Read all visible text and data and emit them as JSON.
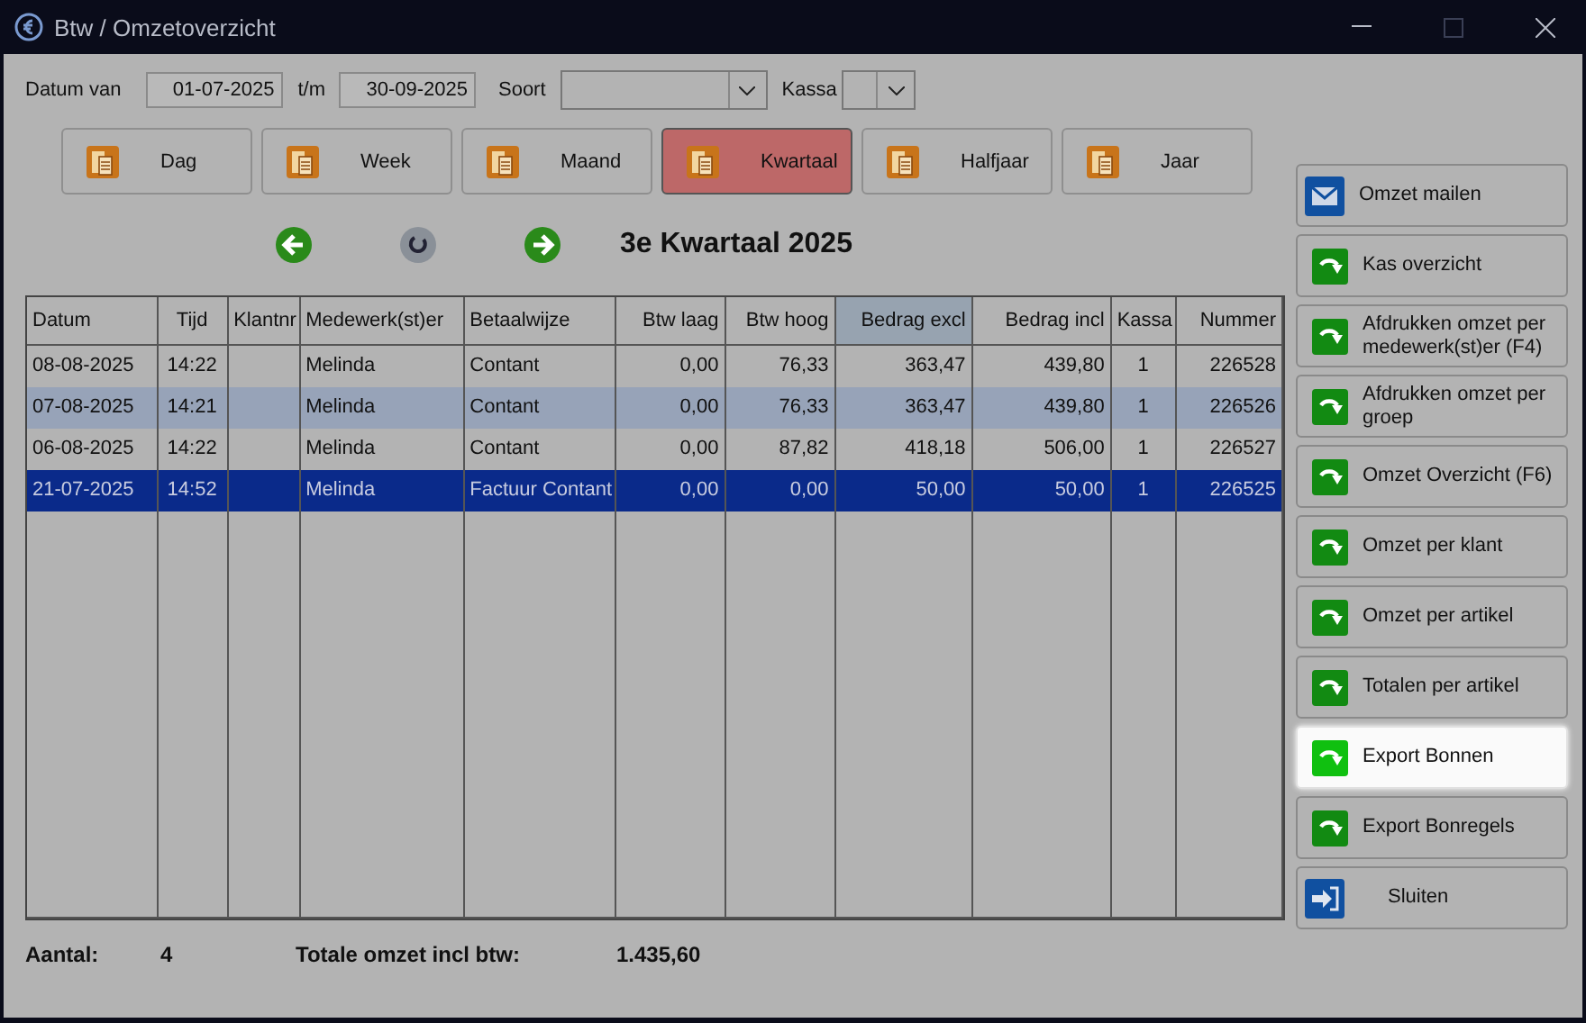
{
  "window": {
    "title": "Btw / Omzetoverzicht"
  },
  "filters": {
    "date_from_label": "Datum van",
    "date_from": "01-07-2025",
    "date_to_label": "t/m",
    "date_to": "30-09-2025",
    "type_label": "Soort",
    "register_label": "Kassa"
  },
  "periods": [
    {
      "label": "Dag",
      "selected": false
    },
    {
      "label": "Week",
      "selected": false
    },
    {
      "label": "Maand",
      "selected": false
    },
    {
      "label": "Kwartaal",
      "selected": true
    },
    {
      "label": "Halfjaar",
      "selected": false
    },
    {
      "label": "Jaar",
      "selected": false
    }
  ],
  "period_title": "3e Kwartaal 2025",
  "table": {
    "columns": [
      {
        "label": "Datum",
        "sorted": false
      },
      {
        "label": "Tijd",
        "sorted": false
      },
      {
        "label": "Klantnr",
        "sorted": false
      },
      {
        "label": "Medewerk(st)er",
        "sorted": false
      },
      {
        "label": "Betaalwijze",
        "sorted": false
      },
      {
        "label": "Btw laag",
        "sorted": false
      },
      {
        "label": "Btw hoog",
        "sorted": false
      },
      {
        "label": "Bedrag excl",
        "sorted": true
      },
      {
        "label": "Bedrag incl",
        "sorted": false
      },
      {
        "label": "Kassa",
        "sorted": false
      },
      {
        "label": "Nummer",
        "sorted": false
      }
    ],
    "rows": [
      {
        "selected": false,
        "highlighted": false,
        "cells": [
          "08-08-2025",
          "14:22",
          "",
          "Melinda",
          "Contant",
          "0,00",
          "76,33",
          "363,47",
          "439,80",
          "1",
          "226528"
        ]
      },
      {
        "selected": false,
        "highlighted": true,
        "cells": [
          "07-08-2025",
          "14:21",
          "",
          "Melinda",
          "Contant",
          "0,00",
          "76,33",
          "363,47",
          "439,80",
          "1",
          "226526"
        ]
      },
      {
        "selected": false,
        "highlighted": false,
        "cells": [
          "06-08-2025",
          "14:22",
          "",
          "Melinda",
          "Contant",
          "0,00",
          "87,82",
          "418,18",
          "506,00",
          "1",
          "226527"
        ]
      },
      {
        "selected": true,
        "highlighted": false,
        "cells": [
          "21-07-2025",
          "14:52",
          "",
          "Melinda",
          "Factuur Contant",
          "0,00",
          "0,00",
          "50,00",
          "50,00",
          "1",
          "226525"
        ]
      }
    ]
  },
  "actions": [
    {
      "label": "Omzet mailen",
      "kind": "mail",
      "highlighted": false
    },
    {
      "label": "Kas overzicht",
      "kind": "report",
      "highlighted": false
    },
    {
      "label": "Afdrukken omzet per medewerk(st)er (F4)",
      "kind": "report",
      "highlighted": false
    },
    {
      "label": "Afdrukken omzet per groep",
      "kind": "report",
      "highlighted": false
    },
    {
      "label": "Omzet Overzicht (F6)",
      "kind": "report",
      "highlighted": false
    },
    {
      "label": "Omzet per klant",
      "kind": "report",
      "highlighted": false
    },
    {
      "label": "Omzet per artikel",
      "kind": "report",
      "highlighted": false
    },
    {
      "label": "Totalen per artikel",
      "kind": "report",
      "highlighted": false
    },
    {
      "label": "Export Bonnen",
      "kind": "report",
      "highlighted": true
    },
    {
      "label": "Export Bonregels",
      "kind": "report",
      "highlighted": false
    },
    {
      "label": "Sluiten",
      "kind": "exit",
      "highlighted": false
    }
  ],
  "footer": {
    "count_label": "Aantal:",
    "count": "4",
    "total_label": "Totale omzet incl btw:",
    "total": "1.435,60"
  }
}
